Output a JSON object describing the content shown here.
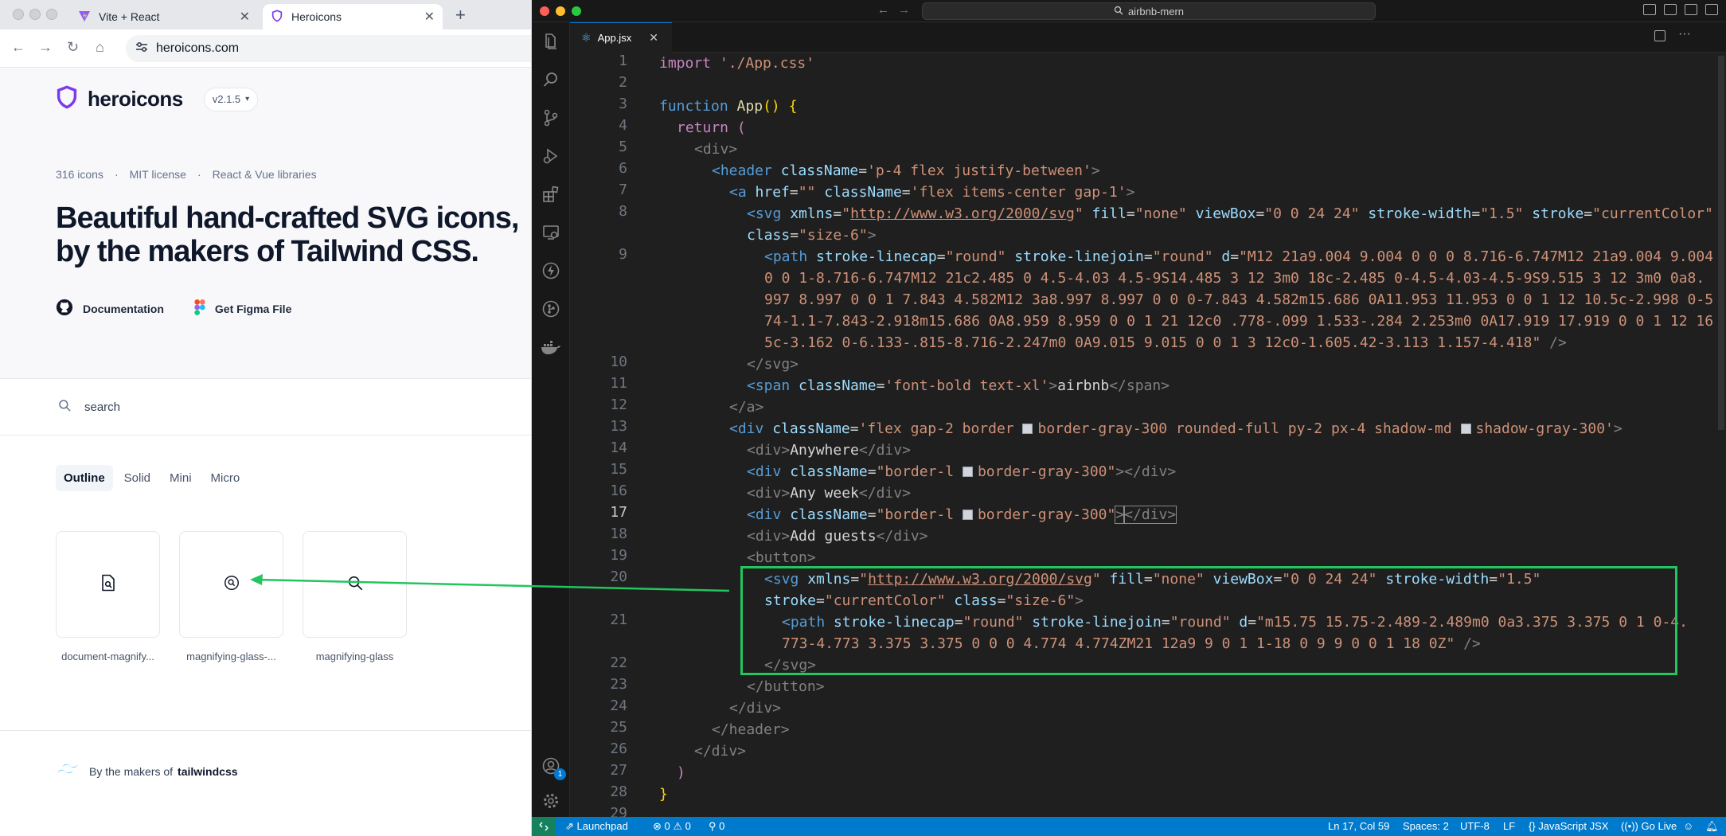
{
  "browser": {
    "tabs": [
      {
        "title": "Vite + React",
        "active": false
      },
      {
        "title": "Heroicons",
        "active": true
      }
    ],
    "url": "heroicons.com"
  },
  "heroicons": {
    "logo_text": "heroicons",
    "version": "v2.1.5",
    "meta": [
      "316 icons",
      "·",
      "MIT license",
      "·",
      "React & Vue libraries"
    ],
    "headline_line1": "Beautiful hand-crafted SVG icons,",
    "headline_line2": "by the makers of Tailwind CSS.",
    "links": {
      "documentation": "Documentation",
      "figma": "Get Figma File"
    },
    "search_placeholder": "search",
    "style_tabs": [
      "Outline",
      "Solid",
      "Mini",
      "Micro"
    ],
    "active_style": "Outline",
    "icons": [
      {
        "name": "document-magnify...",
        "icon": "document-magnifying-glass-icon"
      },
      {
        "name": "magnifying-glass-...",
        "icon": "magnifying-glass-circle-icon"
      },
      {
        "name": "magnifying-glass",
        "icon": "magnifying-glass-icon"
      }
    ],
    "footer_prefix": "By the makers of",
    "footer_brand": "tailwindcss"
  },
  "vscode": {
    "window_title": "airbnb-mern",
    "file_tab": "App.jsx",
    "activity_icons": [
      "explorer-icon",
      "search-icon",
      "source-control-icon",
      "run-debug-icon",
      "extensions-icon",
      "remote-explorer-icon",
      "lightning-icon",
      "gitlens-icon",
      "docker-icon",
      "account-icon",
      "settings-icon"
    ],
    "line_numbers": [
      "1",
      "2",
      "3",
      "4",
      "5",
      "6",
      "7",
      "8",
      "",
      "9",
      "",
      "",
      "",
      "",
      "10",
      "11",
      "12",
      "13",
      "14",
      "15",
      "16",
      "17",
      "18",
      "19",
      "20",
      "",
      "21",
      "",
      "22",
      "23",
      "24",
      "25",
      "26",
      "27",
      "28",
      "29"
    ],
    "current_line": "17",
    "code": {
      "l1a": "import",
      "l1b": " './App.css'",
      "l3a": "function",
      "l3b": " App",
      "l3c": "() {",
      "l4a": "return",
      "l4b": " (",
      "l5": "<div>",
      "l6a": "<header",
      "l6b": " className",
      "l6c": "=",
      "l6d": "'p-4 flex justify-between'",
      "l6e": ">",
      "l7a": "<a",
      "l7b": " href",
      "l7c": "=",
      "l7d": "\"\"",
      "l7e": " className",
      "l7f": "=",
      "l7g": "'flex items-center gap-1'",
      "l7h": ">",
      "l8a": "<svg",
      "l8b": " xmlns",
      "l8c": "=",
      "l8d": "\"",
      "l8e": "http://www.w3.org/2000/svg",
      "l8f": "\"",
      "l8g": " fill",
      "l8h": "=",
      "l8i": "\"none\"",
      "l8j": " viewBox",
      "l8k": "=",
      "l8l": "\"0 0 24 24\"",
      "l8m": " stroke-width",
      "l8n": "=",
      "l8o": "\"1.5\"",
      "l8p": " stroke",
      "l8q": "=",
      "l8r": "\"currentColor\"",
      "l8w1": "class",
      "l8w2": "=",
      "l8w3": "\"size-6\"",
      "l8w4": ">",
      "l9a": "<path",
      "l9b": " stroke-linecap",
      "l9c": "=",
      "l9d": "\"round\"",
      "l9e": " stroke-linejoin",
      "l9f": "=",
      "l9g": "\"round\"",
      "l9h": " d",
      "l9i": "=",
      "l9j": "\"M12 21a9.004 9.004 0 0 0 8.716-6.747M12 21a9.004 9.004",
      "l9w1": "0 0 1-8.716-6.747M12 21c2.485 0 4.5-4.03 4.5-9S14.485 3 12 3m0 18c-2.485 0-4.5-4.03-4.5-9S9.515 3 12 3m0 0a8.",
      "l9w2": "997 8.997 0 0 1 7.843 4.582M12 3a8.997 8.997 0 0 0-7.843 4.582m15.686 0A11.953 11.953 0 0 1 12 10.5c-2.998 0-5.",
      "l9w3": "74-1.1-7.843-2.918m15.686 0A8.959 8.959 0 0 1 21 12c0 .778-.099 1.533-.284 2.253m0 0A17.919 17.919 0 0 1 12 16.",
      "l9w4": "5c-3.162 0-6.133-.815-8.716-2.247m0 0A9.015 9.015 0 0 1 3 12c0-1.605.42-3.113 1.157-4.418\"",
      "l9w5": " />",
      "l10": "</svg>",
      "l11a": "<span",
      "l11b": " className",
      "l11c": "=",
      "l11d": "'font-bold text-xl'",
      "l11e": ">",
      "l11f": "airbnb",
      "l11g": "</span>",
      "l12": "</a>",
      "l13a": "<div",
      "l13b": " className",
      "l13c": "=",
      "l13d": "'flex gap-2 border ",
      "l13e": "border-gray-300 rounded-full py-2 px-4 shadow-md ",
      "l13f": "shadow-gray-300'",
      "l13g": ">",
      "l14a": "<div>",
      "l14b": "Anywhere",
      "l14c": "</div>",
      "l15a": "<div",
      "l15b": " className",
      "l15c": "=",
      "l15d": "\"border-l ",
      "l15e": "border-gray-300\"",
      "l15f": "></div>",
      "l16a": "<div>",
      "l16b": "Any week",
      "l16c": "</div>",
      "l17a": "<div",
      "l17b": " className",
      "l17c": "=",
      "l17d": "\"border-l ",
      "l17e": "border-gray-300\"",
      "l17f": ">",
      "l17g": "</div>",
      "l18a": "<div>",
      "l18b": "Add guests",
      "l18c": "</div>",
      "l19": "<button>",
      "l20a": "<svg",
      "l20b": " xmlns",
      "l20c": "=",
      "l20d": "\"",
      "l20e": "http://www.w3.org/2000/svg",
      "l20f": "\"",
      "l20g": " fill",
      "l20h": "=",
      "l20i": "\"none\"",
      "l20j": " viewBox",
      "l20k": "=",
      "l20l": "\"0 0 24 24\"",
      "l20m": " stroke-width",
      "l20n": "=",
      "l20o": "\"1.5\"",
      "l20w1": "stroke",
      "l20w2": "=",
      "l20w3": "\"currentColor\"",
      "l20w4": " class",
      "l20w5": "=",
      "l20w6": "\"size-6\"",
      "l20w7": ">",
      "l21a": "<path",
      "l21b": " stroke-linecap",
      "l21c": "=",
      "l21d": "\"round\"",
      "l21e": " stroke-linejoin",
      "l21f": "=",
      "l21g": "\"round\"",
      "l21h": " d",
      "l21i": "=",
      "l21j": "\"m15.75 15.75-2.489-2.489m0 0a3.375 3.375 0 1 0-4.",
      "l21w1": "773-4.773 3.375 3.375 0 0 0 4.774 4.774ZM21 12a9 9 0 1 1-18 0 9 9 0 0 1 18 0Z\"",
      "l21w2": " />",
      "l22": "</svg>",
      "l23": "</button>",
      "l24": "</div>",
      "l25": "</header>",
      "l26": "</div>",
      "l27": ")",
      "l28": "}"
    },
    "status": {
      "launchpad": "Launchpad",
      "errors": "0",
      "warnings": "0",
      "ports": "0",
      "position": "Ln 17, Col 59",
      "spaces": "Spaces: 2",
      "encoding": "UTF-8",
      "eol": "LF",
      "language": "JavaScript JSX",
      "golive": "Go Live",
      "account_badge": "1"
    }
  },
  "colors": {
    "highlight_box": "#22c55e",
    "vscode_statusbar": "#007acc",
    "editor_bg": "#1f1f1f"
  }
}
